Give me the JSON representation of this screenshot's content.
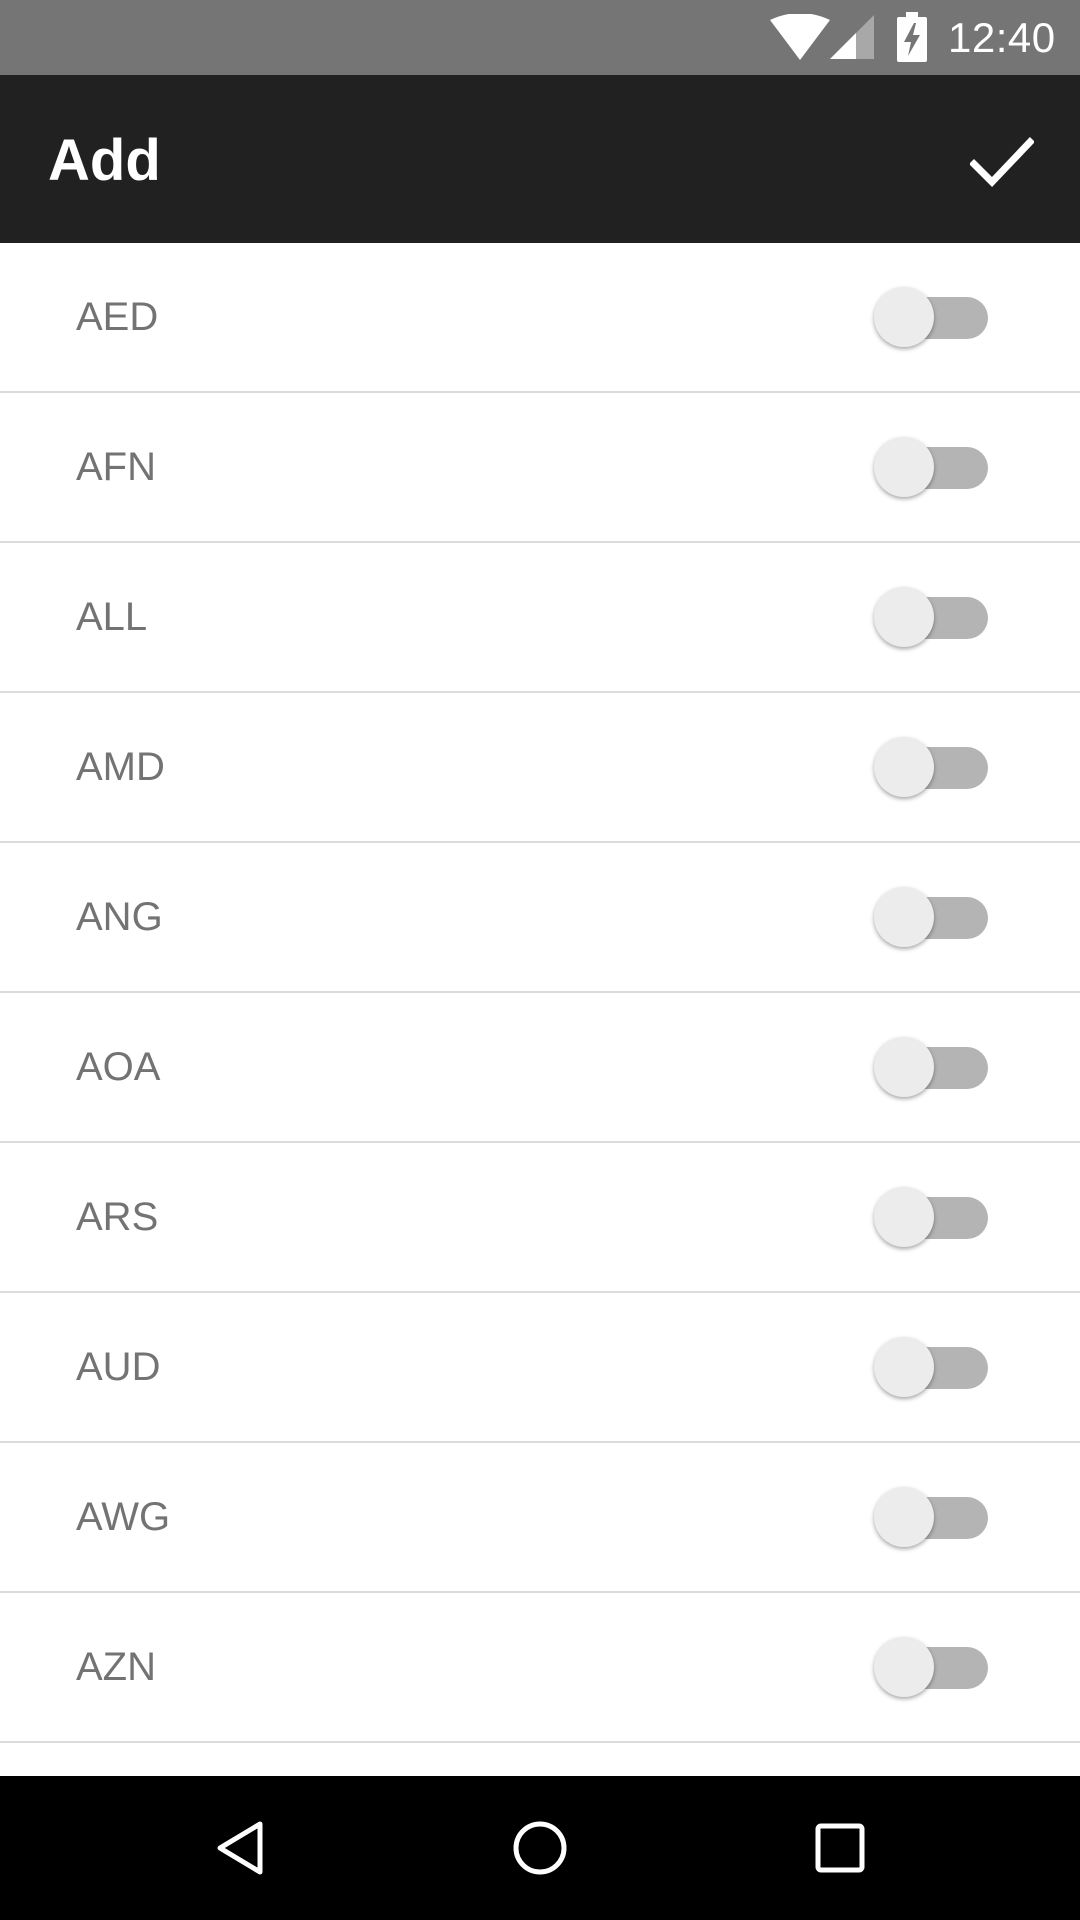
{
  "status_bar": {
    "time": "12:40",
    "icons": [
      "wifi-icon",
      "cell-signal-icon",
      "battery-charging-icon"
    ]
  },
  "app_bar": {
    "title": "Add",
    "confirm_icon": "checkmark-icon"
  },
  "currencies": [
    {
      "code": "AED",
      "enabled": false
    },
    {
      "code": "AFN",
      "enabled": false
    },
    {
      "code": "ALL",
      "enabled": false
    },
    {
      "code": "AMD",
      "enabled": false
    },
    {
      "code": "ANG",
      "enabled": false
    },
    {
      "code": "AOA",
      "enabled": false
    },
    {
      "code": "ARS",
      "enabled": false
    },
    {
      "code": "AUD",
      "enabled": false
    },
    {
      "code": "AWG",
      "enabled": false
    },
    {
      "code": "AZN",
      "enabled": false
    }
  ],
  "nav_bar": {
    "buttons": [
      "back-icon",
      "home-icon",
      "recents-icon"
    ]
  },
  "colors": {
    "status_bar": "#757575",
    "app_bar": "#212121",
    "row_text": "#737373",
    "switch_track_off": "#b4b4b4",
    "switch_thumb_off": "#ececec",
    "divider": "#dcdcdc",
    "nav_bar": "#000000"
  }
}
